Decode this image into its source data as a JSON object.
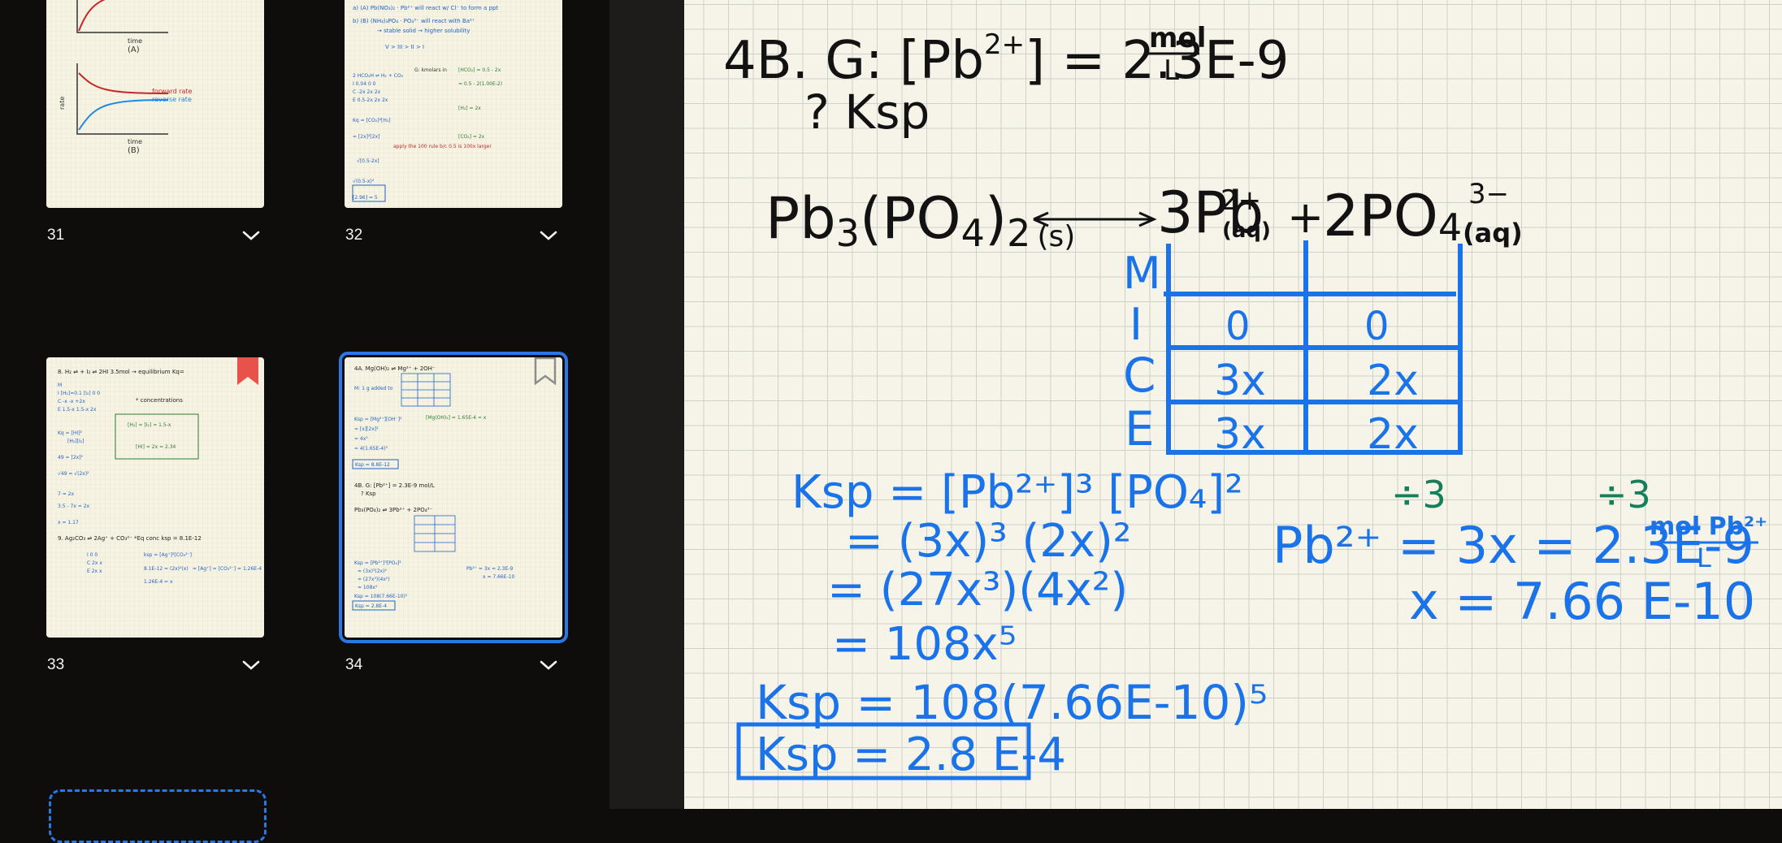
{
  "sidebar": {
    "pages": [
      {
        "number": "31",
        "thumb_text": {
          "legend": "forward rate\nreverse rate",
          "label_a": "(A)",
          "label_b": "(B)",
          "axis_x": "time",
          "axis_y": "rate"
        }
      },
      {
        "number": "32",
        "thumb_text": {
          "line1": "a) (A) Pb(NO₃)₂ · Pb²⁺ will react w/ Cl⁻ to form a ppt",
          "line2": "b) (B) (NH₄)₃PO₄ · PO₄³⁻ will react with Ba²⁺"
        }
      },
      {
        "number": "33",
        "bookmarked": true
      },
      {
        "number": "34",
        "selected": true,
        "bookmarked": false
      }
    ]
  },
  "note": {
    "line1": "4B. G: [Pb",
    "line1_sup": "2+",
    "line1_rest": "] = 2.3E-9",
    "line1_unit_num": "mol",
    "line1_unit_den": "L",
    "line2": "? Ksp",
    "equation": {
      "reactant": "Pb",
      "reactant_sub3": "3",
      "reactant_po4": "(PO",
      "reactant_sub4": "4",
      "reactant_close": ")",
      "reactant_sub2": "2",
      "reactant_state": "(s)",
      "arrow": "⟷",
      "product1": "3Pb",
      "product1_sup": "2+",
      "product1_state": "(aq)",
      "plus": "+",
      "product2": "2PO",
      "product2_sub": "4",
      "product2_sup": "3−",
      "product2_state": "(aq)"
    },
    "ice_table": {
      "rows": [
        "M",
        "I",
        "C",
        "E"
      ],
      "col1": [
        "",
        "0",
        "3x",
        "3x"
      ],
      "col2": [
        "",
        "0",
        "2x",
        "2x"
      ]
    },
    "ksp_lines": [
      "Ksp = [Pb²⁺]³ [PO₄]²",
      "= (3x)³ (2x)²",
      "= (27x³)(4x²)",
      "= 108x⁵"
    ],
    "ksp_sub": "Ksp = 108(7.66E-10)⁵",
    "ksp_answer": "Ksp = 2.8 E-4",
    "div1": "÷3",
    "div2": "÷3",
    "solve_line1": "Pb²⁺ = 3x = 2.3E-9",
    "solve_unit_num": "mol Pb²⁺",
    "solve_unit_den": "L",
    "solve_line2": "x = 7.66 E-10"
  },
  "colors": {
    "ink_black": "#121212",
    "ink_blue": "#1a73e8",
    "ink_green": "#13805b",
    "selection": "#2a78e4",
    "bookmark_red": "#e8524a",
    "paper": "#f6f4e9",
    "sidebar_bg": "#0f0d0c"
  }
}
